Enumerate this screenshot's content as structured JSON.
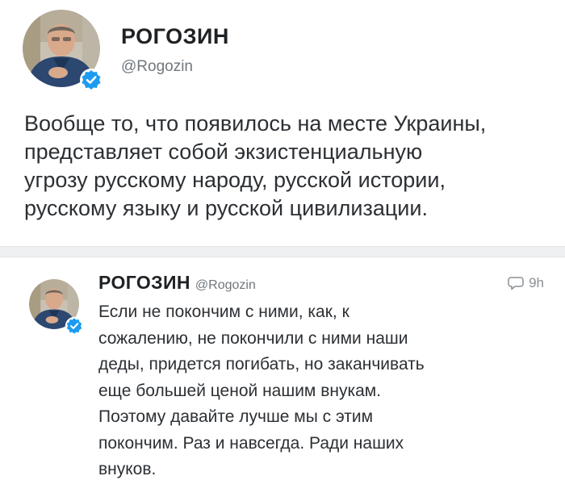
{
  "main_tweet": {
    "author_name": "РОГОЗИН",
    "author_handle": "@Rogozin",
    "text_lines": [
      "Вообще то, что появилось на месте Украины,",
      "представляет собой экзистенциальную",
      "угрозу русскому народу, русской истории,",
      "русскому языку и русской цивилизации."
    ]
  },
  "reply_tweet": {
    "author_name": "РОГОЗИН",
    "author_handle": "@Rogozin",
    "time": "9h",
    "text_lines": [
      "Если не покончим с ними, как, к",
      "сожалению, не покончили с ними наши",
      "деды, придется погибать, но заканчивать",
      "еще большей ценой нашим внукам.",
      "Поэтому давайте лучше мы с этим",
      "покончим. Раз и навсегда. Ради наших",
      "внуков."
    ]
  },
  "icons": {
    "verified": "verified-badge-icon",
    "reply": "reply-bubble-icon"
  },
  "colors": {
    "verified_blue": "#1d9bf0",
    "divider": "#eef0f1",
    "text": "#2c3034",
    "secondary_text": "#70777d"
  }
}
